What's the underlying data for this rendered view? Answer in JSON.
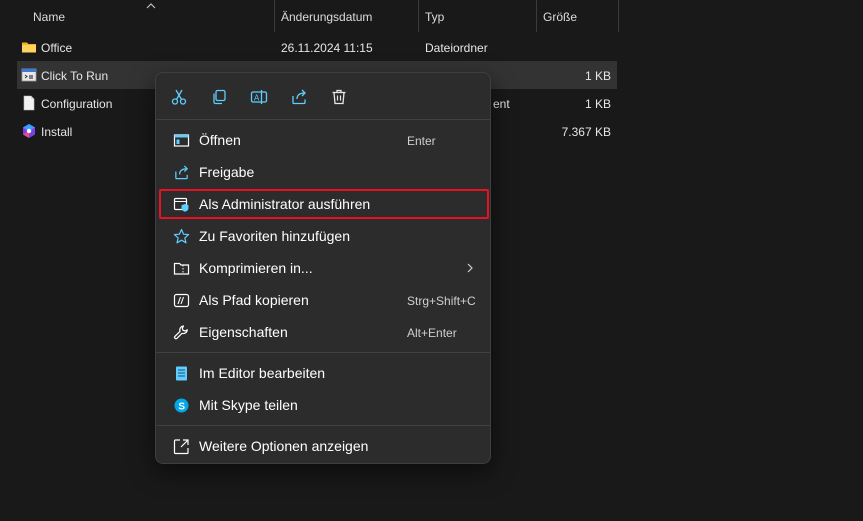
{
  "columns": {
    "name": "Name",
    "date": "Änderungsdatum",
    "type": "Typ",
    "size": "Größe"
  },
  "files": [
    {
      "name": "Office",
      "date": "26.11.2024 11:15",
      "type": "Dateiordner",
      "size": "",
      "icon": "folder-icon"
    },
    {
      "name": "Click To Run",
      "date": "",
      "type": "",
      "size": "1 KB",
      "icon": "batch-file-icon"
    },
    {
      "name": "Configuration",
      "date": "",
      "type": "ent",
      "size": "1 KB",
      "icon": "document-icon"
    },
    {
      "name": "Install",
      "date": "",
      "type": "",
      "size": "7.367 KB",
      "icon": "office-setup-icon"
    }
  ],
  "context_menu": {
    "quick_actions": [
      {
        "label": "cut",
        "icon": "scissors-icon"
      },
      {
        "label": "copy",
        "icon": "copy-icon"
      },
      {
        "label": "rename",
        "icon": "rename-icon"
      },
      {
        "label": "share",
        "icon": "share-icon"
      },
      {
        "label": "delete",
        "icon": "trash-icon"
      }
    ],
    "items": [
      {
        "label": "Öffnen",
        "shortcut": "Enter",
        "icon": "open-icon"
      },
      {
        "label": "Freigabe",
        "shortcut": "",
        "icon": "share-icon"
      },
      {
        "label": "Als Administrator ausführen",
        "shortcut": "",
        "icon": "admin-shield-icon"
      },
      {
        "label": "Zu Favoriten hinzufügen",
        "shortcut": "",
        "icon": "star-icon"
      },
      {
        "label": "Komprimieren in...",
        "shortcut": "",
        "icon": "zip-folder-icon"
      },
      {
        "label": "Als Pfad kopieren",
        "shortcut": "Strg+Shift+C",
        "icon": "copy-path-icon"
      },
      {
        "label": "Eigenschaften",
        "shortcut": "Alt+Enter",
        "icon": "wrench-icon"
      },
      {
        "label": "Im Editor bearbeiten",
        "shortcut": "",
        "icon": "notepad-icon"
      },
      {
        "label": "Mit Skype teilen",
        "shortcut": "",
        "icon": "skype-icon"
      },
      {
        "label": "Weitere Optionen anzeigen",
        "shortcut": "",
        "icon": "more-options-icon"
      }
    ]
  },
  "colors": {
    "background": "#191919",
    "menu_bg": "#2c2c2c",
    "highlight_border": "#e81123",
    "accent": "#60cdff"
  }
}
